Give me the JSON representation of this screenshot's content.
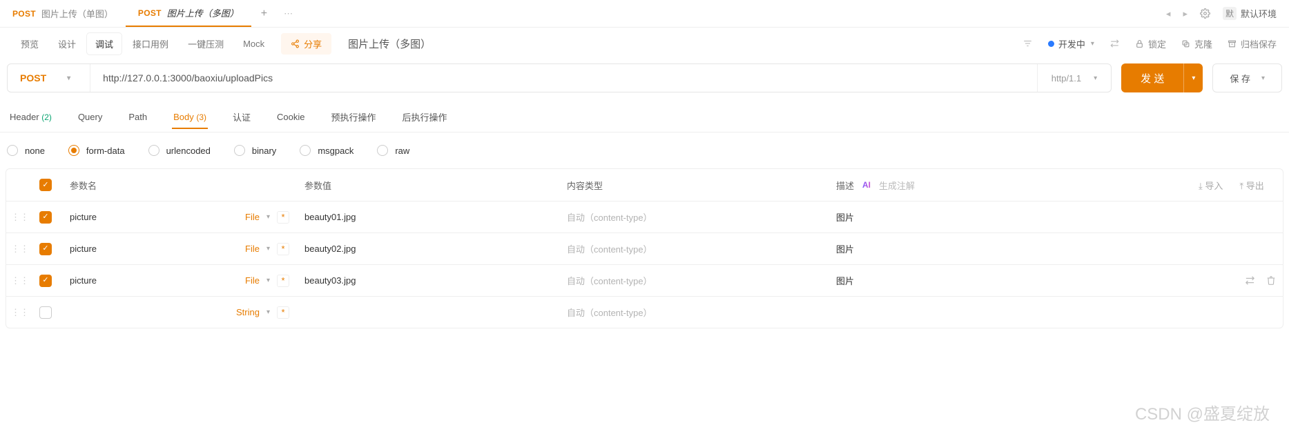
{
  "colors": {
    "accent": "#e77c00"
  },
  "tabs": [
    {
      "method": "POST",
      "label": "图片上传（单图）",
      "active": false
    },
    {
      "method": "POST",
      "label": "图片上传（多图）",
      "active": true
    }
  ],
  "env": {
    "badge": "默",
    "label": "默认环境"
  },
  "toolbar": {
    "items": [
      "预览",
      "设计",
      "调试",
      "接口用例",
      "一键压测",
      "Mock"
    ],
    "active_index": 2,
    "share": "分享",
    "title": "图片上传（多图）",
    "status": "开发中",
    "lock": "锁定",
    "clone": "克隆",
    "archive": "归档保存"
  },
  "request": {
    "method": "POST",
    "url": "http://127.0.0.1:3000/baoxiu/uploadPics",
    "protocol": "http/1.1",
    "send": "发 送",
    "save": "保 存"
  },
  "subtabs": [
    {
      "label": "Header",
      "count": "(2)"
    },
    {
      "label": "Query"
    },
    {
      "label": "Path"
    },
    {
      "label": "Body",
      "count": "(3)",
      "active": true
    },
    {
      "label": "认证"
    },
    {
      "label": "Cookie"
    },
    {
      "label": "预执行操作"
    },
    {
      "label": "后执行操作"
    }
  ],
  "body_types": [
    "none",
    "form-data",
    "urlencoded",
    "binary",
    "msgpack",
    "raw"
  ],
  "body_type_selected": 1,
  "table": {
    "headers": {
      "name": "参数名",
      "value": "参数值",
      "ctype": "内容类型",
      "desc": "描述",
      "gen": "生成注解",
      "import": "导入",
      "export": "导出"
    },
    "ctype_placeholder": "自动（content-type）",
    "rows": [
      {
        "checked": true,
        "name": "picture",
        "type": "File",
        "value": "beauty01.jpg",
        "desc": "图片"
      },
      {
        "checked": true,
        "name": "picture",
        "type": "File",
        "value": "beauty02.jpg",
        "desc": "图片"
      },
      {
        "checked": true,
        "name": "picture",
        "type": "File",
        "value": "beauty03.jpg",
        "desc": "图片",
        "hover": true
      },
      {
        "checked": false,
        "name": "",
        "type": "String",
        "value": "",
        "desc": ""
      }
    ]
  },
  "watermark": "CSDN @盛夏绽放"
}
